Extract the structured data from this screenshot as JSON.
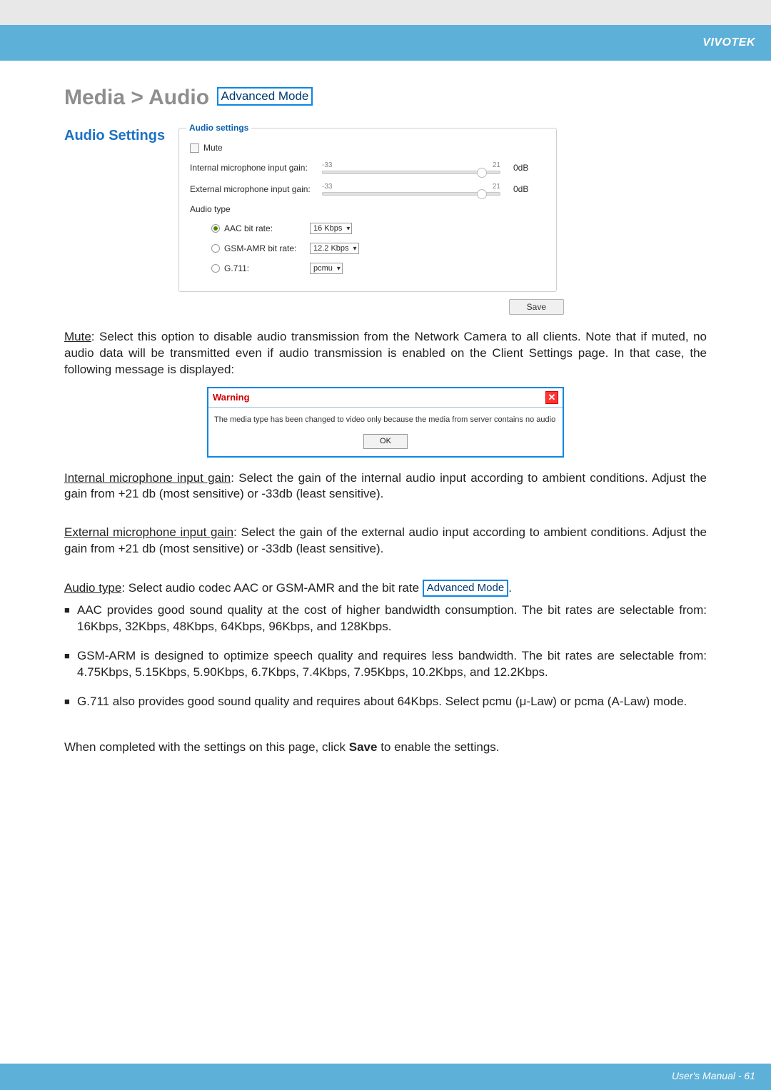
{
  "header": {
    "brand": "VIVOTEK"
  },
  "breadcrumb": "Media > Audio",
  "advanced_mode": "Advanced Mode",
  "section_title": "Audio Settings",
  "panel": {
    "legend": "Audio settings",
    "mute": "Mute",
    "internal_gain_label": "Internal microphone input gain:",
    "external_gain_label": "External microphone input gain:",
    "slider_min": "-33",
    "slider_max": "21",
    "slider_value": "0dB",
    "audio_type_label": "Audio type",
    "aac_label": "AAC bit rate:",
    "aac_value": "16 Kbps",
    "gsm_label": "GSM-AMR bit rate:",
    "gsm_value": "12.2 Kbps",
    "g711_label": "G.711:",
    "g711_value": "pcmu"
  },
  "save_label": "Save",
  "doc": {
    "mute_heading": "Mute",
    "mute_text": ": Select this option to disable audio transmission from the Network Camera to all clients. Note that if muted, no audio data will be transmitted even if audio transmission is enabled on the Client Settings page. In that case, the following message is displayed:",
    "dialog": {
      "title": "Warning",
      "message": "The media type has been changed to video only because the media from server contains no audio",
      "ok": "OK"
    },
    "internal_heading": "Internal microphone input gain",
    "internal_text": ": Select the gain of the internal audio input according to ambient conditions. Adjust the gain from +21 db (most sensitive) or -33db (least sensitive).",
    "external_heading": "External microphone input gain",
    "external_text": ": Select the gain of the external audio input according to ambient conditions. Adjust the gain from +21 db (most sensitive) or -33db (least sensitive).",
    "audio_type_heading": "Audio type",
    "audio_type_text_before": ": Select audio codec AAC or GSM-AMR and the bit rate ",
    "audio_type_text_after": ".",
    "bullets": [
      "AAC provides good sound quality at the cost of higher bandwidth consumption. The bit rates are selectable from: 16Kbps, 32Kbps, 48Kbps, 64Kbps, 96Kbps, and 128Kbps.",
      "GSM-ARM is designed to optimize speech quality and requires less bandwidth. The bit rates are selectable from: 4.75Kbps, 5.15Kbps, 5.90Kbps, 6.7Kbps, 7.4Kbps, 7.95Kbps, 10.2Kbps, and 12.2Kbps.",
      "G.711 also provides good sound quality and requires about 64Kbps. Select pcmu (μ-Law) or pcma (A-Law) mode."
    ],
    "closing_before": "When completed with the settings on this page, click ",
    "save_bold": "Save",
    "closing_after": " to enable the settings."
  },
  "footer": {
    "text": "User's Manual - 61"
  }
}
